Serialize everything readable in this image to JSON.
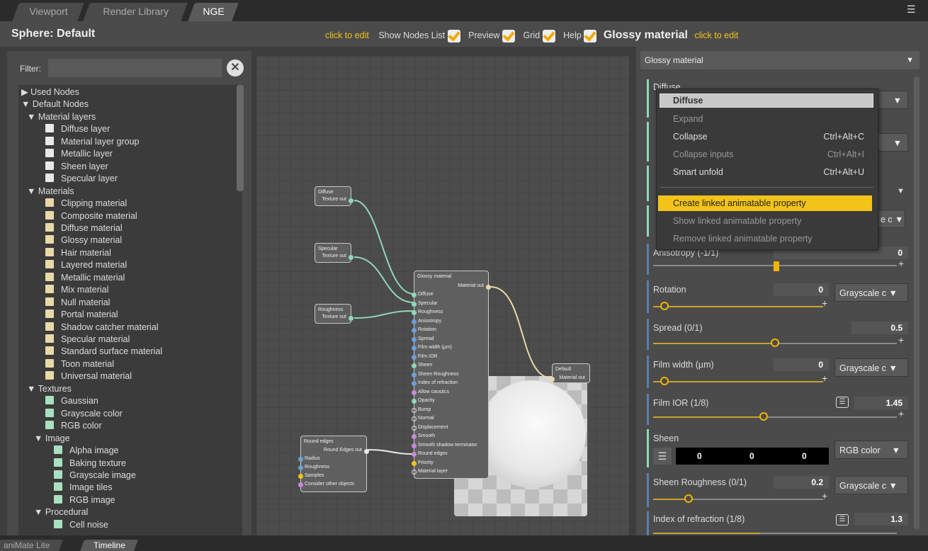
{
  "tabs": [
    {
      "label": "Viewport"
    },
    {
      "label": "Render Library"
    },
    {
      "label": "NGE"
    }
  ],
  "header": {
    "title": "Sphere: Default",
    "click_edit_1": "click to edit",
    "show_nodes": "Show Nodes List",
    "preview": "Preview",
    "grid": "Grid",
    "help": "Help",
    "material": "Glossy material",
    "click_edit_2": "click to edit"
  },
  "filter": {
    "label": "Filter:",
    "value": ""
  },
  "tree": [
    {
      "t": "▶ Used Nodes",
      "lvl": 0
    },
    {
      "t": "▼ Default Nodes",
      "lvl": 0
    },
    {
      "t": "▼ Material layers",
      "lvl": 1
    },
    {
      "t": "Diffuse layer",
      "lvl": 2,
      "c": "#e8e8e8"
    },
    {
      "t": "Material layer group",
      "lvl": 2,
      "c": "#e8e8e8"
    },
    {
      "t": "Metallic layer",
      "lvl": 2,
      "c": "#e8e8e8"
    },
    {
      "t": "Sheen layer",
      "lvl": 2,
      "c": "#e8e8e8"
    },
    {
      "t": "Specular layer",
      "lvl": 2,
      "c": "#e8e8e8"
    },
    {
      "t": "▼ Materials",
      "lvl": 1
    },
    {
      "t": "Clipping material",
      "lvl": 2,
      "c": "#e8d9a8"
    },
    {
      "t": "Composite material",
      "lvl": 2,
      "c": "#e8d9a8"
    },
    {
      "t": "Diffuse material",
      "lvl": 2,
      "c": "#e8d9a8"
    },
    {
      "t": "Glossy material",
      "lvl": 2,
      "c": "#e8d9a8"
    },
    {
      "t": "Hair material",
      "lvl": 2,
      "c": "#e8d9a8"
    },
    {
      "t": "Layered material",
      "lvl": 2,
      "c": "#e8d9a8"
    },
    {
      "t": "Metallic material",
      "lvl": 2,
      "c": "#e8d9a8"
    },
    {
      "t": "Mix material",
      "lvl": 2,
      "c": "#e8d9a8"
    },
    {
      "t": "Null material",
      "lvl": 2,
      "c": "#e8d9a8"
    },
    {
      "t": "Portal material",
      "lvl": 2,
      "c": "#e8d9a8"
    },
    {
      "t": "Shadow catcher material",
      "lvl": 2,
      "c": "#e8d9a8"
    },
    {
      "t": "Specular material",
      "lvl": 2,
      "c": "#e8d9a8"
    },
    {
      "t": "Standard surface material",
      "lvl": 2,
      "c": "#e8d9a8"
    },
    {
      "t": "Toon material",
      "lvl": 2,
      "c": "#e8d9a8"
    },
    {
      "t": "Universal material",
      "lvl": 2,
      "c": "#e8d9a8"
    },
    {
      "t": "▼ Textures",
      "lvl": 1
    },
    {
      "t": "Gaussian",
      "lvl": 2,
      "c": "#a8e0c0"
    },
    {
      "t": "Grayscale color",
      "lvl": 2,
      "c": "#a8e0c0"
    },
    {
      "t": "RGB color",
      "lvl": 2,
      "c": "#a8e0c0"
    },
    {
      "t": "▼ Image",
      "lvl": 1.5
    },
    {
      "t": "Alpha image",
      "lvl": 3,
      "c": "#a8e0c0"
    },
    {
      "t": "Baking texture",
      "lvl": 3,
      "c": "#a8e0c0"
    },
    {
      "t": "Grayscale image",
      "lvl": 3,
      "c": "#a8e0c0"
    },
    {
      "t": "Image tiles",
      "lvl": 3,
      "c": "#a8e0c0"
    },
    {
      "t": "RGB image",
      "lvl": 3,
      "c": "#a8e0c0"
    },
    {
      "t": "▼ Procedural",
      "lvl": 1.5
    },
    {
      "t": "Cell noise",
      "lvl": 3,
      "c": "#a8e0c0"
    }
  ],
  "nodes": {
    "diffuse": {
      "title": "Diffuse",
      "out": "Texture out"
    },
    "specular": {
      "title": "Specular",
      "out": "Texture out"
    },
    "roughness": {
      "title": "Roughness",
      "out": "Texture out"
    },
    "glossy": {
      "title": "Glossy material",
      "out": "Material out",
      "inputs": [
        "Diffuse",
        "Specular",
        "Roughness",
        "Anisotropy",
        "Rotation",
        "Spread",
        "Film width (μm)",
        "Film IOR",
        "Sheen",
        "Sheen Roughness",
        "Index of refraction",
        "Allow caustics",
        "Opacity",
        "Bump",
        "Normal",
        "Displacement",
        "Smooth",
        "Smooth shadow terminator",
        "Round edges",
        "Priority",
        "Material layer"
      ]
    },
    "default": {
      "title": "Default",
      "out": "Material out"
    },
    "round": {
      "title": "Round edges",
      "out": "Round Edges out",
      "inputs": [
        "Radius",
        "Roughness",
        "Samples",
        "Consider other objects"
      ]
    }
  },
  "right": {
    "dropdown": "Glossy material",
    "diffuse_label": "Diffuse",
    "anisotropy": {
      "label": "Anisotropy (-1/1)",
      "value": "0"
    },
    "rotation": {
      "label": "Rotation",
      "value": "0",
      "btn": "Grayscale c ▼"
    },
    "spread": {
      "label": "Spread (0/1)",
      "value": "0.5"
    },
    "film_width": {
      "label": "Film width (µm)",
      "value": "0",
      "btn": "Grayscale c ▼"
    },
    "film_ior": {
      "label": "Film IOR (1/8)",
      "value": "1.45"
    },
    "sheen": {
      "label": "Sheen",
      "r": "0",
      "g": "0",
      "b": "0",
      "btn": "RGB color"
    },
    "sheen_rough": {
      "label": "Sheen Roughness (0/1)",
      "value": "0.2",
      "btn": "Grayscale c ▼"
    },
    "ior": {
      "label": "Index of refraction (1/8)",
      "value": "1.3"
    }
  },
  "menu": {
    "header": "Diffuse",
    "expand": "Expand",
    "collapse": "Collapse",
    "collapse_sc": "Ctrl+Alt+C",
    "collapse_inputs": "Collapse inputs",
    "collapse_inputs_sc": "Ctrl+Alt+I",
    "smart_unfold": "Smart unfold",
    "smart_unfold_sc": "Ctrl+Alt+U",
    "create_linked": "Create linked animatable property",
    "show_linked": "Show linked animatable property",
    "remove_linked": "Remove linked animatable property"
  },
  "bottom": {
    "tab1": "aniMate Lite",
    "tab2": "Timeline"
  }
}
